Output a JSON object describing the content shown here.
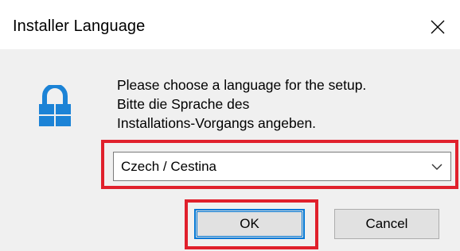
{
  "window": {
    "title": "Installer Language",
    "close_icon": "close-icon"
  },
  "message": {
    "line1": "Please choose a language for the setup.",
    "line2": "Bitte die Sprache des",
    "line3": "Installations-Vorgangs angeben."
  },
  "language_select": {
    "value": "Czech / Cestina",
    "chevron_icon": "chevron-down-icon"
  },
  "buttons": {
    "ok_label": "OK",
    "cancel_label": "Cancel"
  },
  "icons": {
    "app_icon": "lock-icon"
  },
  "colors": {
    "accent": "#0078d7",
    "highlight": "#e0202c"
  }
}
